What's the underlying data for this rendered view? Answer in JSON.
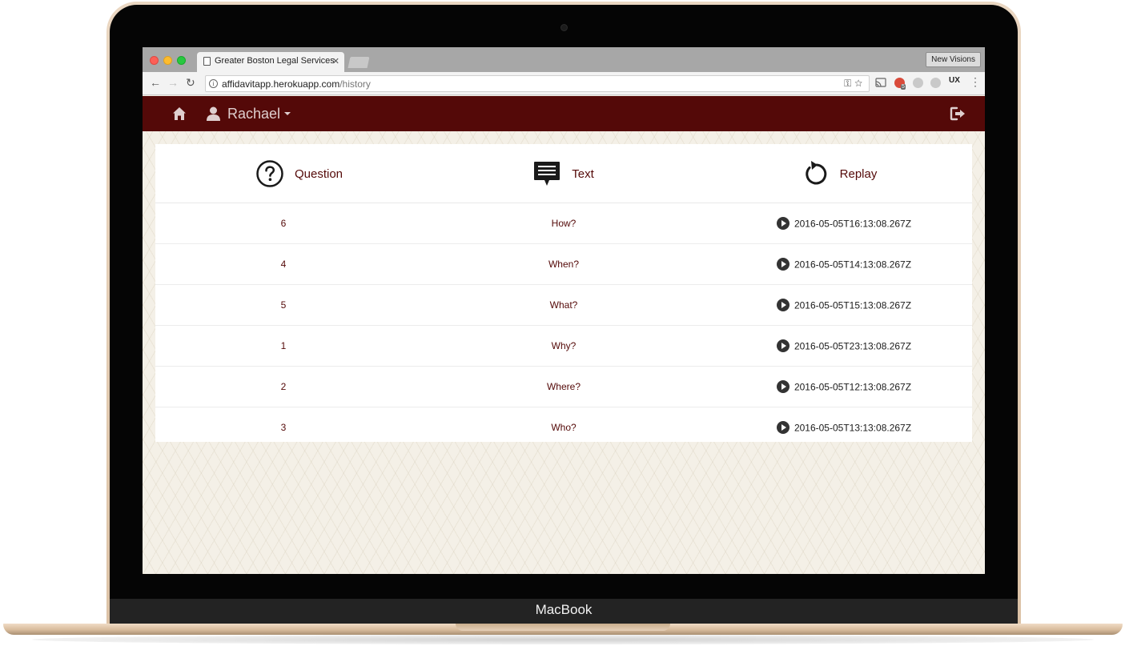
{
  "device": {
    "brand": "MacBook"
  },
  "browser": {
    "tab_title": "Greater Boston Legal Services",
    "profile": "New Visions",
    "url_host": "affidavitapp.herokuapp.com",
    "url_path": "/history",
    "icons": [
      "back-icon",
      "forward-icon",
      "reload-icon",
      "info-icon",
      "key-icon",
      "bookmark-star-icon",
      "cast-icon",
      "extension-icon",
      "menu-icon"
    ],
    "extension_badge": "5",
    "ux_ext": "UX"
  },
  "navbar": {
    "user": "Rachael",
    "bg_color": "#540908",
    "icons": [
      "home-icon",
      "user-icon",
      "logout-icon"
    ]
  },
  "table": {
    "headers": [
      {
        "label": "Question",
        "icon": "question-circle-icon"
      },
      {
        "label": "Text",
        "icon": "comment-icon"
      },
      {
        "label": "Replay",
        "icon": "replay-icon"
      }
    ],
    "rows": [
      {
        "question": "6",
        "text": "How?",
        "replay": "2016-05-05T16:13:08.267Z"
      },
      {
        "question": "4",
        "text": "When?",
        "replay": "2016-05-05T14:13:08.267Z"
      },
      {
        "question": "5",
        "text": "What?",
        "replay": "2016-05-05T15:13:08.267Z"
      },
      {
        "question": "1",
        "text": "Why?",
        "replay": "2016-05-05T23:13:08.267Z"
      },
      {
        "question": "2",
        "text": "Where?",
        "replay": "2016-05-05T12:13:08.267Z"
      },
      {
        "question": "3",
        "text": "Who?",
        "replay": "2016-05-05T13:13:08.267Z"
      }
    ]
  },
  "colors": {
    "accent": "#540908",
    "page_bg": "#f4f0e7"
  }
}
